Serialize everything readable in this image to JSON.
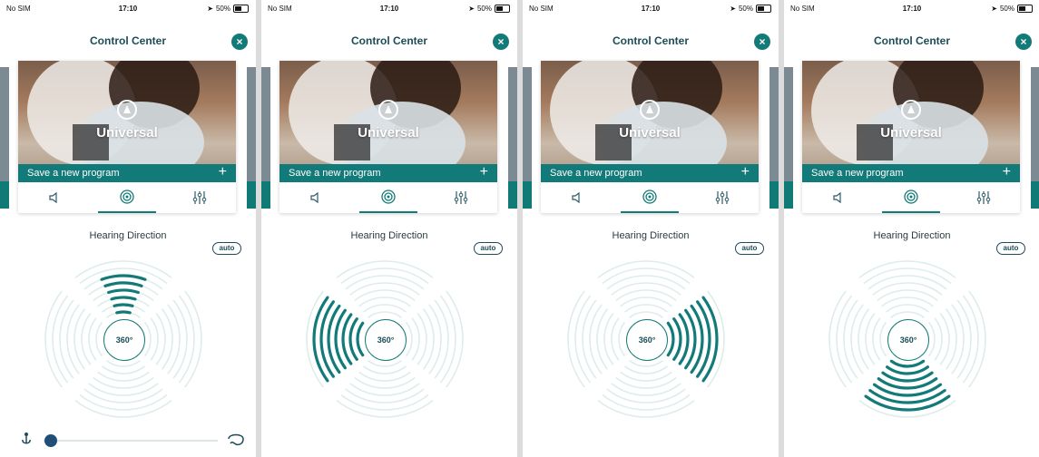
{
  "status": {
    "carrier": "No SIM",
    "time": "17:10",
    "battery": "50%"
  },
  "header": {
    "title": "Control Center",
    "close_glyph": "×"
  },
  "card": {
    "program_name": "Universal",
    "save_label": "Save a new program",
    "plus_glyph": "+",
    "tabs": [
      "volume-icon",
      "directional-icon",
      "equalizer-icon"
    ],
    "active_tab": 1
  },
  "hearing": {
    "title": "Hearing Direction",
    "auto_label": "auto",
    "center_label": "360°"
  },
  "phones": [
    {
      "direction": "front",
      "slider": 0.0,
      "show_slider": true
    },
    {
      "direction": "left",
      "show_slider": false
    },
    {
      "direction": "right",
      "show_slider": false
    },
    {
      "direction": "back",
      "show_slider": false
    }
  ],
  "colors": {
    "accent": "#127a78",
    "text_dark": "#1a4c5a",
    "ring": "#ddecec",
    "slider_thumb": "#1f4e79"
  }
}
